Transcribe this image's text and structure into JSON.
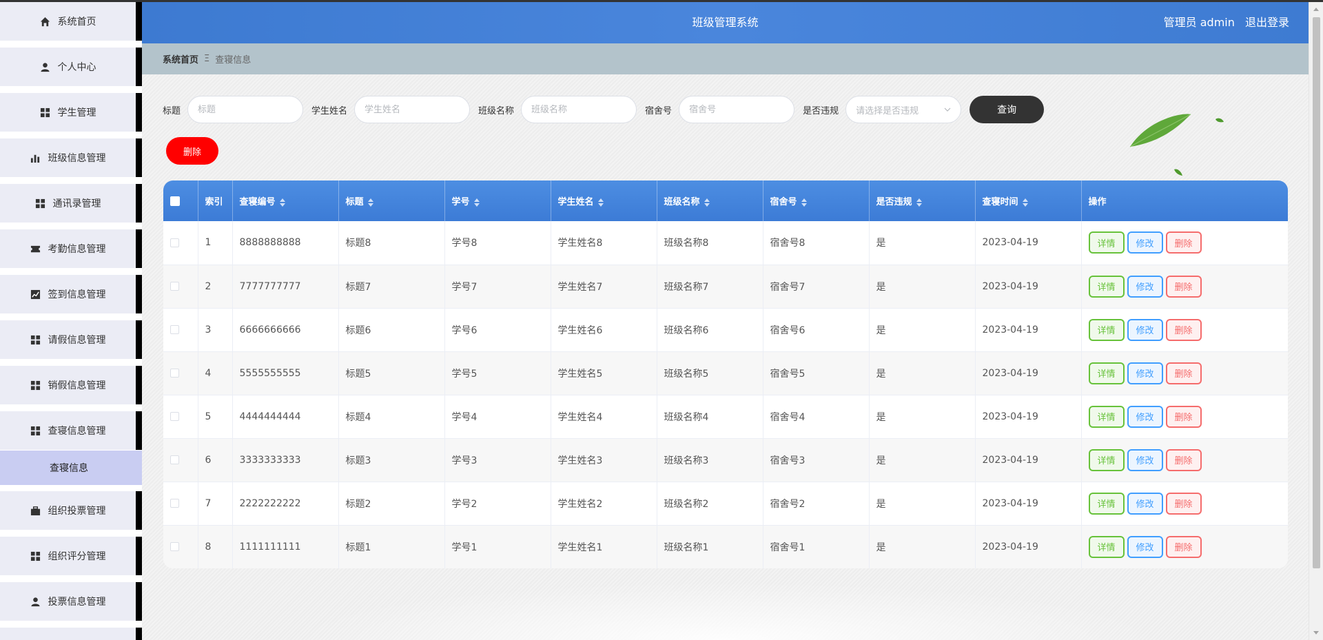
{
  "header": {
    "title": "班级管理系统",
    "user_role": "管理员 admin",
    "logout": "退出登录"
  },
  "breadcrumb": {
    "home": "系统首页",
    "separator": "Ξ",
    "current": "查寝信息"
  },
  "sidebar": {
    "items": [
      {
        "label": "系统首页",
        "icon": "home-icon"
      },
      {
        "label": "个人中心",
        "icon": "user-icon"
      },
      {
        "label": "学生管理",
        "icon": "grid-icon"
      },
      {
        "label": "班级信息管理",
        "icon": "bar-chart-icon"
      },
      {
        "label": "通讯录管理",
        "icon": "grid-icon"
      },
      {
        "label": "考勤信息管理",
        "icon": "ticket-icon"
      },
      {
        "label": "签到信息管理",
        "icon": "line-chart-icon"
      },
      {
        "label": "请假信息管理",
        "icon": "grid-icon"
      },
      {
        "label": "销假信息管理",
        "icon": "grid-icon"
      },
      {
        "label": "查寝信息管理",
        "icon": "grid-icon"
      },
      {
        "label": "组织投票管理",
        "icon": "briefcase-icon"
      },
      {
        "label": "组织评分管理",
        "icon": "grid-icon"
      },
      {
        "label": "投票信息管理",
        "icon": "user-icon"
      }
    ],
    "active_sub": "查寝信息"
  },
  "search": {
    "title_label": "标题",
    "title_placeholder": "标题",
    "name_label": "学生姓名",
    "name_placeholder": "学生姓名",
    "class_label": "班级名称",
    "class_placeholder": "班级名称",
    "dorm_label": "宿舍号",
    "dorm_placeholder": "宿舍号",
    "violation_label": "是否违规",
    "violation_placeholder": "请选择是否违规",
    "query_button": "查询"
  },
  "actions": {
    "delete_button": "删除"
  },
  "table": {
    "headers": [
      "索引",
      "查寝编号",
      "标题",
      "学号",
      "学生姓名",
      "班级名称",
      "宿舍号",
      "是否违规",
      "查寝时间",
      "操作"
    ],
    "op_labels": {
      "detail": "详情",
      "edit": "修改",
      "delete": "删除"
    },
    "rows": [
      {
        "index": "1",
        "code": "8888888888",
        "title": "标题8",
        "student_no": "学号8",
        "name": "学生姓名8",
        "class": "班级名称8",
        "dorm": "宿舍号8",
        "violation": "是",
        "time": "2023-04-19"
      },
      {
        "index": "2",
        "code": "7777777777",
        "title": "标题7",
        "student_no": "学号7",
        "name": "学生姓名7",
        "class": "班级名称7",
        "dorm": "宿舍号7",
        "violation": "是",
        "time": "2023-04-19"
      },
      {
        "index": "3",
        "code": "6666666666",
        "title": "标题6",
        "student_no": "学号6",
        "name": "学生姓名6",
        "class": "班级名称6",
        "dorm": "宿舍号6",
        "violation": "是",
        "time": "2023-04-19"
      },
      {
        "index": "4",
        "code": "5555555555",
        "title": "标题5",
        "student_no": "学号5",
        "name": "学生姓名5",
        "class": "班级名称5",
        "dorm": "宿舍号5",
        "violation": "是",
        "time": "2023-04-19"
      },
      {
        "index": "5",
        "code": "4444444444",
        "title": "标题4",
        "student_no": "学号4",
        "name": "学生姓名4",
        "class": "班级名称4",
        "dorm": "宿舍号4",
        "violation": "是",
        "time": "2023-04-19"
      },
      {
        "index": "6",
        "code": "3333333333",
        "title": "标题3",
        "student_no": "学号3",
        "name": "学生姓名3",
        "class": "班级名称3",
        "dorm": "宿舍号3",
        "violation": "是",
        "time": "2023-04-19"
      },
      {
        "index": "7",
        "code": "2222222222",
        "title": "标题2",
        "student_no": "学号2",
        "name": "学生姓名2",
        "class": "班级名称2",
        "dorm": "宿舍号2",
        "violation": "是",
        "time": "2023-04-19"
      },
      {
        "index": "8",
        "code": "1111111111",
        "title": "标题1",
        "student_no": "学号1",
        "name": "学生姓名1",
        "class": "班级名称1",
        "dorm": "宿舍号1",
        "violation": "是",
        "time": "2023-04-19"
      }
    ]
  },
  "colors": {
    "header_blue": "#3d7ad1",
    "delete_red": "#ff0000",
    "detail_green": "#67c23a",
    "edit_blue": "#409eff",
    "danger_red": "#f56c6c"
  }
}
